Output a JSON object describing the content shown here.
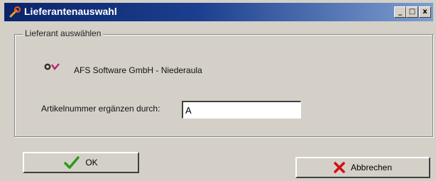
{
  "window": {
    "title": "Lieferantenauswahl",
    "controls": {
      "minimize": "_",
      "maximize": "□",
      "close": "x"
    }
  },
  "group": {
    "legend": "Lieferant auswählen",
    "supplier_icon": "afs-logo-icon",
    "supplier_name": "AFS Software GmbH - Niederaula"
  },
  "field": {
    "label": "Artikelnummer ergänzen durch:",
    "value": "A"
  },
  "buttons": {
    "ok_label": "OK",
    "ok_icon": "checkmark-icon",
    "cancel_label": "Abbrechen",
    "cancel_icon": "red-x-icon"
  },
  "colors": {
    "titlebar_start": "#0a246a",
    "titlebar_end": "#7f9fd0",
    "ok_check": "#2a9a1e",
    "cancel_x": "#d01010"
  }
}
